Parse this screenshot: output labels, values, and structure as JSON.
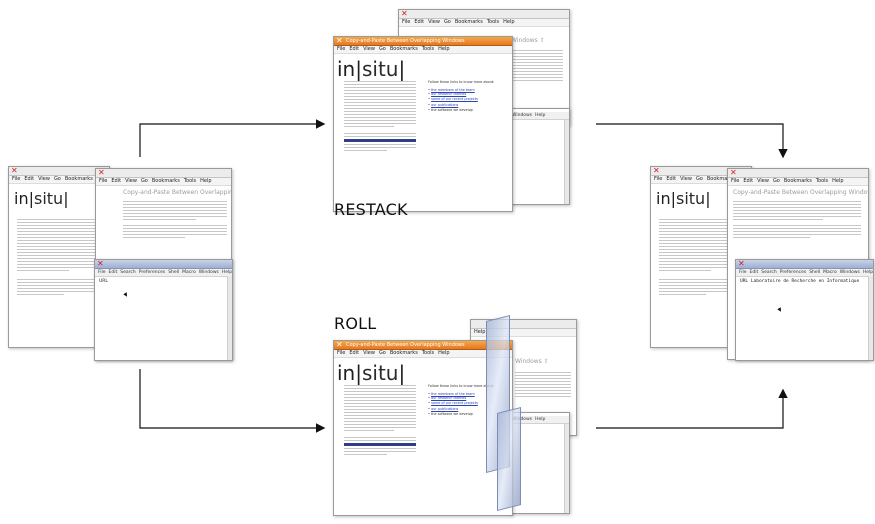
{
  "labels": {
    "restack": "RESTACK",
    "roll": "ROLL"
  },
  "win_title": "Copy-and-Paste Between Overlapping Windows",
  "menu": [
    "File",
    "Edit",
    "View",
    "Go",
    "Bookmarks",
    "Tools",
    "Help"
  ],
  "logo": {
    "a": "in",
    "b": "situ"
  },
  "editor": {
    "menu": [
      "File",
      "Edit",
      "Search",
      "Preferences",
      "Shell",
      "Macro",
      "Windows",
      "Help"
    ],
    "url_before": "URL",
    "url_after": "URL  Laboratoire de Recherche en Informatique"
  },
  "side": {
    "intro": "Follow these links to know more about:",
    "items": [
      "the members of the team",
      "our research themes",
      "some of our recent projects",
      "our publications",
      "the software we develop"
    ]
  },
  "colors": {
    "accent": "#e57820",
    "selection": "#2d3f88",
    "link": "#2a43b5"
  }
}
